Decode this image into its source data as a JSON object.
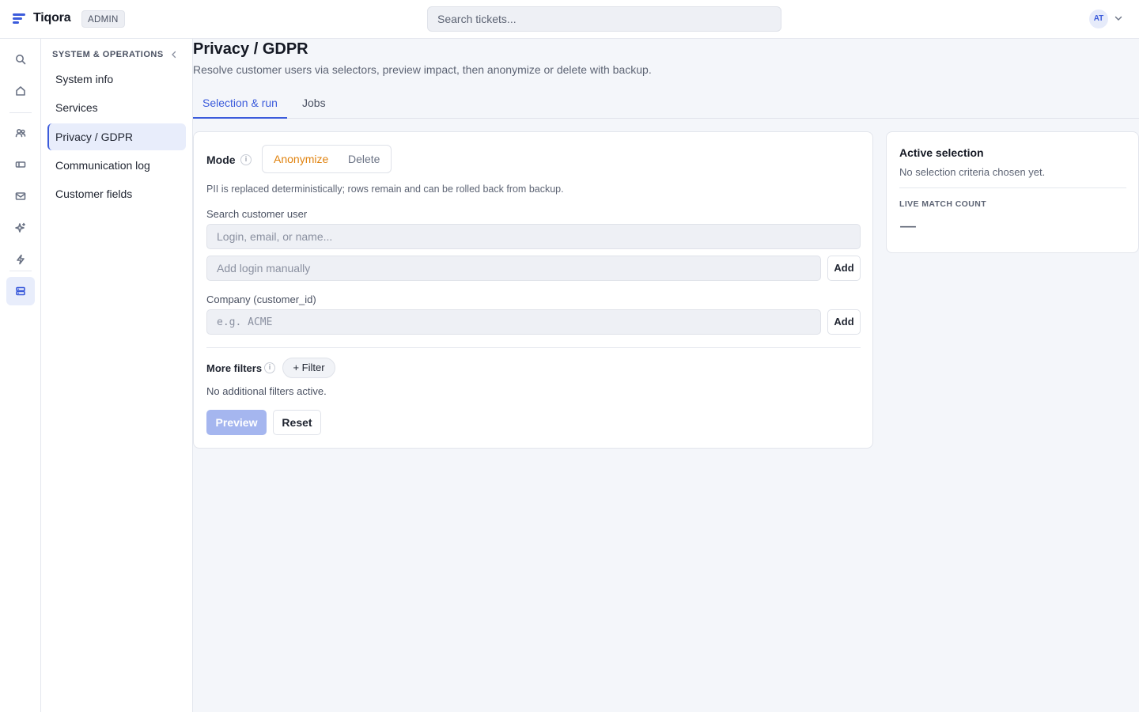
{
  "app": {
    "brand": "Tiqora",
    "badge": "ADMIN"
  },
  "topbar": {
    "search_placeholder": "Search tickets...",
    "avatar_initials": "AT"
  },
  "rail": {
    "items": [
      {
        "icon": "search-icon",
        "active": false
      },
      {
        "icon": "home-icon",
        "active": false
      },
      {
        "icon": "users-icon",
        "active": false
      },
      {
        "icon": "ticket-icon",
        "active": false
      },
      {
        "icon": "mail-icon",
        "active": false
      },
      {
        "icon": "sparkle-icon",
        "active": false
      },
      {
        "icon": "lightning-icon",
        "active": false
      },
      {
        "icon": "server-icon",
        "active": true
      }
    ]
  },
  "subnav": {
    "title": "SYSTEM & OPERATIONS",
    "items": [
      {
        "label": "System info",
        "active": false
      },
      {
        "label": "Services",
        "active": false
      },
      {
        "label": "Privacy / GDPR",
        "active": true
      },
      {
        "label": "Communication log",
        "active": false
      },
      {
        "label": "Customer fields",
        "active": false
      }
    ]
  },
  "page": {
    "title": "Privacy / GDPR",
    "subtitle": "Resolve customer users via selectors, preview impact, then anonymize or delete with backup."
  },
  "tabs": [
    {
      "label": "Selection & run",
      "active": true
    },
    {
      "label": "Jobs",
      "active": false
    }
  ],
  "form": {
    "mode_label": "Mode",
    "info_glyph": "i",
    "modes": [
      {
        "label": "Anonymize",
        "active": true
      },
      {
        "label": "Delete",
        "active": false
      }
    ],
    "mode_help": "PII is replaced deterministically; rows remain and can be rolled back from backup.",
    "search_label": "Search customer user",
    "search_placeholder": "Login, email, or name...",
    "manual_placeholder": "Add login manually",
    "add_label": "Add",
    "company_label": "Company (customer_id)",
    "company_placeholder": "e.g. ACME",
    "more_filters_label": "More filters",
    "filter_button": "+ Filter",
    "no_filters": "No additional filters active.",
    "preview_label": "Preview",
    "reset_label": "Reset"
  },
  "side": {
    "title": "Active selection",
    "empty": "No selection criteria chosen yet.",
    "count_label": "LIVE MATCH COUNT",
    "count_value": "—"
  },
  "colors": {
    "accent": "#3b5bdb",
    "mode_active": "#e0820e",
    "preview_disabled": "#a5b6ef"
  }
}
